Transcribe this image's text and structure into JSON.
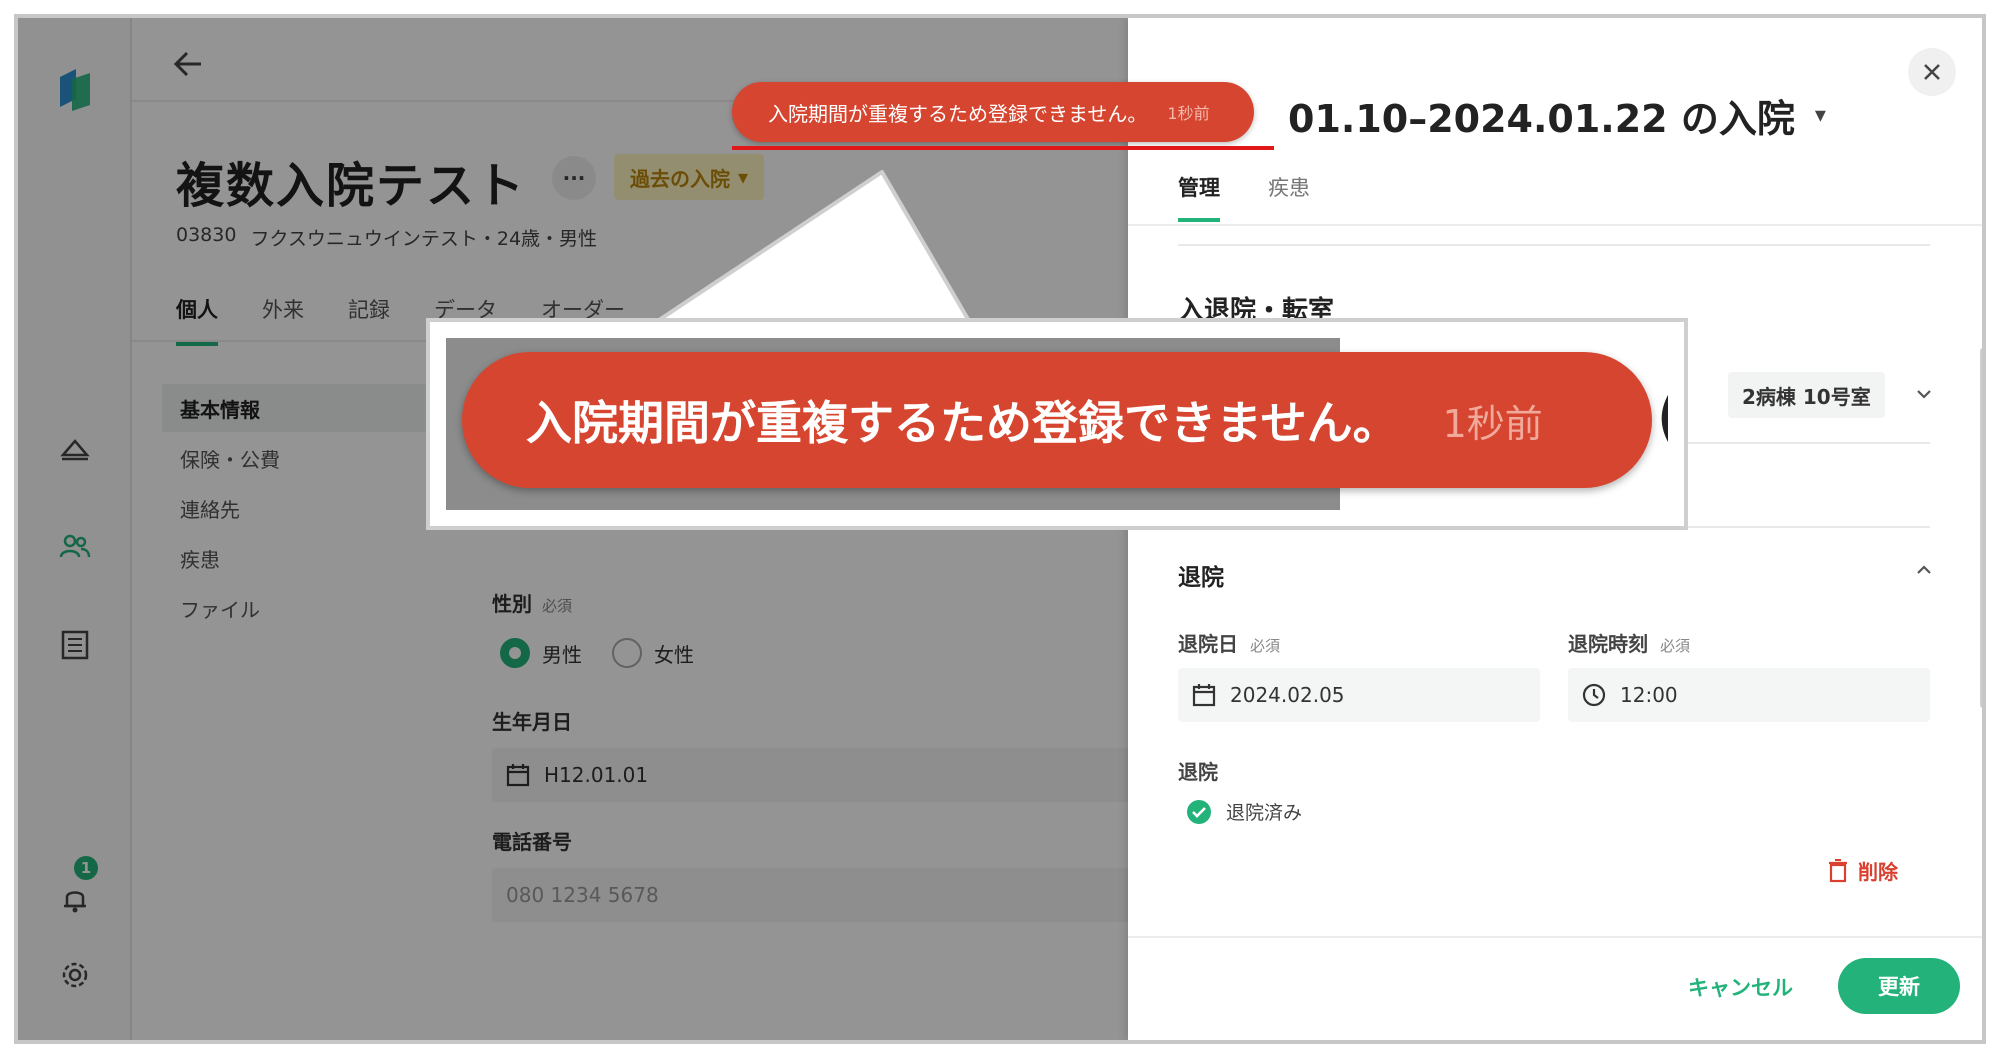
{
  "app": {
    "notification_count": "1"
  },
  "header": {
    "patient_name": "複数入院テスト",
    "more_label": "···",
    "past_admission_label": "過去の入院",
    "patient_id": "03830",
    "patient_kana": "フクスウニュウインテスト・24歳・男性"
  },
  "tabs": [
    {
      "label": "個人"
    },
    {
      "label": "外来"
    },
    {
      "label": "記録"
    },
    {
      "label": "データ"
    },
    {
      "label": "オーダー"
    }
  ],
  "subnav": [
    {
      "label": "基本情報"
    },
    {
      "label": "保険・公費"
    },
    {
      "label": "連絡先"
    },
    {
      "label": "疾患"
    },
    {
      "label": "ファイル"
    }
  ],
  "form": {
    "sex_label": "性別",
    "required": "必須",
    "sex_male": "男性",
    "sex_female": "女性",
    "birth_label": "生年月日",
    "birth_value": "H12.01.01",
    "phone_label": "電話番号",
    "phone_placeholder": "080 1234 5678"
  },
  "drawer": {
    "title": "01.10–2024.01.22 の入院",
    "tabs": [
      {
        "label": "管理"
      },
      {
        "label": "疾患"
      }
    ],
    "section_heading": "入退院・転室",
    "room_value": "2病棟 10号室",
    "discharge_title": "退院",
    "discharge_date_label": "退院日",
    "discharge_time_label": "退院時刻",
    "required": "必須",
    "discharge_date_value": "2024.02.05",
    "discharge_time_value": "12:00",
    "discharge_status_label": "退院",
    "discharge_status_value": "退院済み",
    "delete_label": "削除",
    "cancel_label": "キャンセル",
    "update_label": "更新"
  },
  "toast": {
    "message": "入院期間が重複するため登録できません。",
    "time": "1秒前",
    "zoom_glyph": "("
  },
  "colors": {
    "accent": "#23b27a",
    "toast": "#d6452f",
    "danger": "#d94030",
    "highlight_line": "#e01818"
  }
}
